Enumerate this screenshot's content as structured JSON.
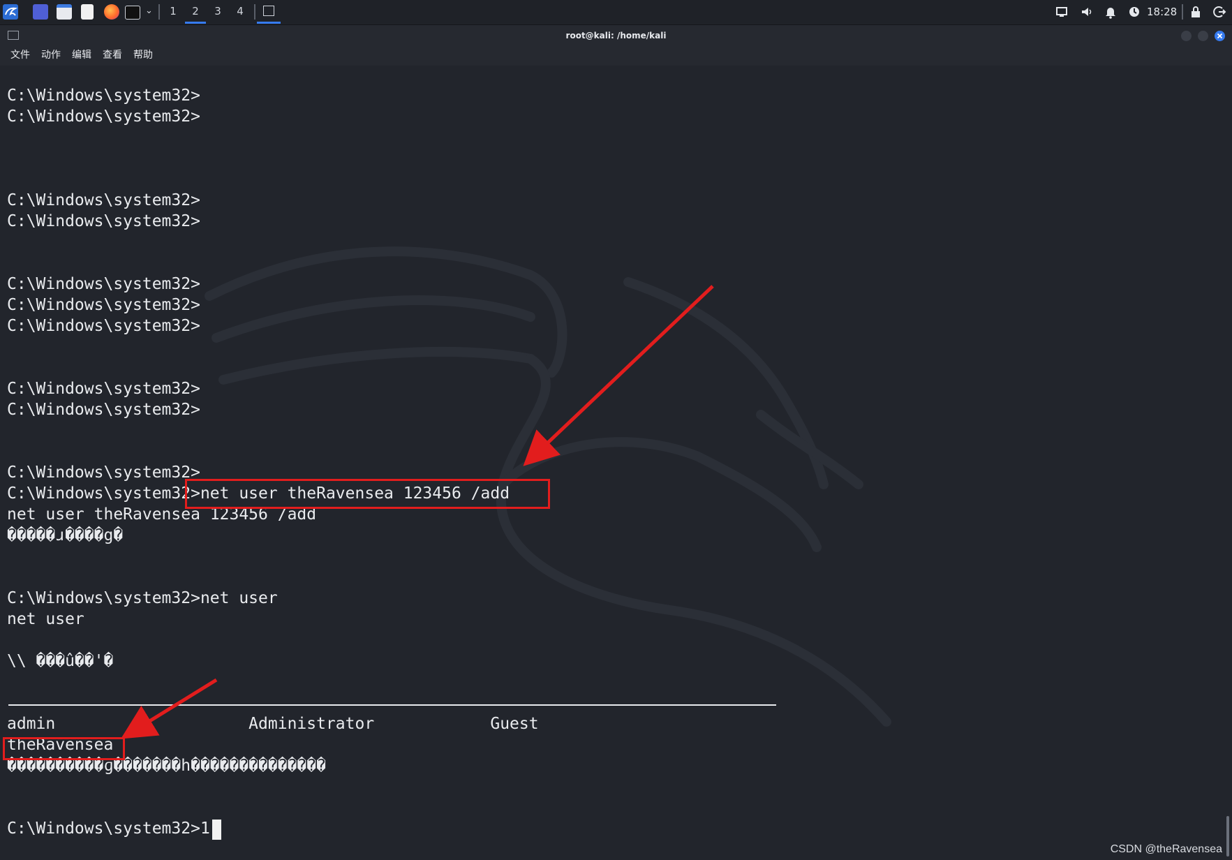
{
  "taskbar": {
    "workspaces": [
      "1",
      "2",
      "3",
      "4"
    ],
    "active_workspace": "2",
    "clock": "18:28"
  },
  "window": {
    "title": "root@kali: /home/kali"
  },
  "menu": [
    "文件",
    "动作",
    "编辑",
    "查看",
    "帮助"
  ],
  "terminal": {
    "lines": [
      {
        "text": "C:\\Windows\\system32>"
      },
      {
        "text": "C:\\Windows\\system32>"
      },
      {
        "text": ""
      },
      {
        "text": ""
      },
      {
        "text": "C:\\Windows\\system32>"
      },
      {
        "text": "C:\\Windows\\system32>"
      },
      {
        "text": ""
      },
      {
        "text": ""
      },
      {
        "text": "C:\\Windows\\system32>"
      },
      {
        "text": "C:\\Windows\\system32>"
      },
      {
        "text": "C:\\Windows\\system32>"
      },
      {
        "text": ""
      },
      {
        "text": ""
      },
      {
        "text": "C:\\Windows\\system32>"
      },
      {
        "text": "C:\\Windows\\system32>"
      },
      {
        "text": ""
      },
      {
        "text": ""
      },
      {
        "text": "C:\\Windows\\system32>"
      },
      {
        "text": "C:\\Windows\\system32>net user theRavensea 123456 /add"
      },
      {
        "text": "net user theRavensea 123456 /add"
      },
      {
        "text": "�����ɹ����g�"
      },
      {
        "text": ""
      },
      {
        "text": ""
      },
      {
        "text": "C:\\Windows\\system32>net user"
      },
      {
        "text": "net user"
      },
      {
        "text": ""
      },
      {
        "text": "\\\\ ���û��'�"
      },
      {
        "text": ""
      },
      {
        "text": "admin                    Administrator            Guest"
      },
      {
        "text": "theRavensea"
      },
      {
        "text": "����������ɡ�������h��������������"
      },
      {
        "text": ""
      },
      {
        "text": ""
      },
      {
        "text": "C:\\Windows\\system32>1"
      }
    ]
  },
  "watermark": "CSDN @theRavensea"
}
